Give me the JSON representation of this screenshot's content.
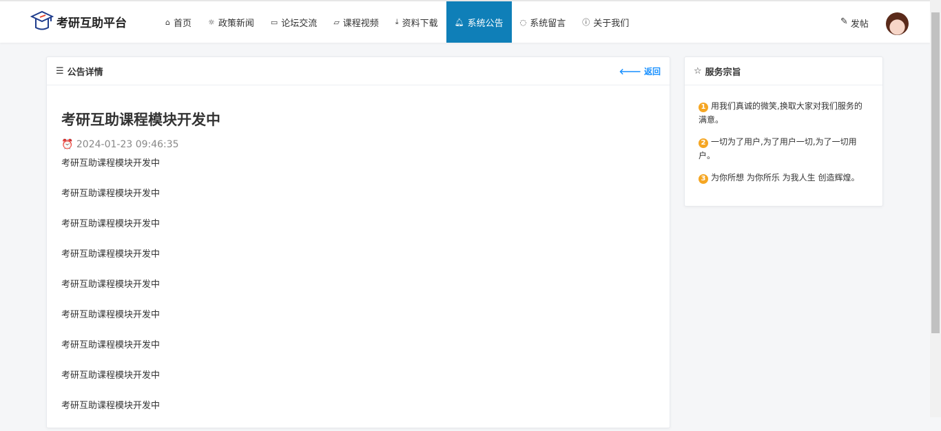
{
  "header": {
    "logo_text": "考研互助平台",
    "nav": [
      {
        "label": "首页",
        "icon": "home-icon"
      },
      {
        "label": "政策新闻",
        "icon": "sun-icon"
      },
      {
        "label": "论坛交流",
        "icon": "chat-icon"
      },
      {
        "label": "课程视频",
        "icon": "video-icon"
      },
      {
        "label": "资料下载",
        "icon": "download-icon"
      },
      {
        "label": "系统公告",
        "icon": "bell-icon"
      },
      {
        "label": "系统留言",
        "icon": "message-icon"
      },
      {
        "label": "关于我们",
        "icon": "info-icon"
      }
    ],
    "active": "系统公告",
    "post_label": "发帖"
  },
  "notice": {
    "header": "公告详情",
    "back": "返回",
    "title": "考研互助课程模块开发中",
    "time": "2024-01-23 09:46:35",
    "paragraphs": [
      "考研互助课程模块开发中",
      "考研互助课程模块开发中",
      "考研互助课程模块开发中",
      "考研互助课程模块开发中",
      "考研互助课程模块开发中",
      "考研互助课程模块开发中",
      "考研互助课程模块开发中",
      "考研互助课程模块开发中",
      "考研互助课程模块开发中"
    ]
  },
  "side": {
    "header": "服务宗旨",
    "items": [
      {
        "n": "1",
        "text": "用我们真诚的微笑,换取大家对我们服务的满意。"
      },
      {
        "n": "2",
        "text": "一切为了用户,为了用户一切,为了一切用户。"
      },
      {
        "n": "3",
        "text": "为你所想 为你所乐 为我人生 创造辉煌。"
      }
    ]
  }
}
